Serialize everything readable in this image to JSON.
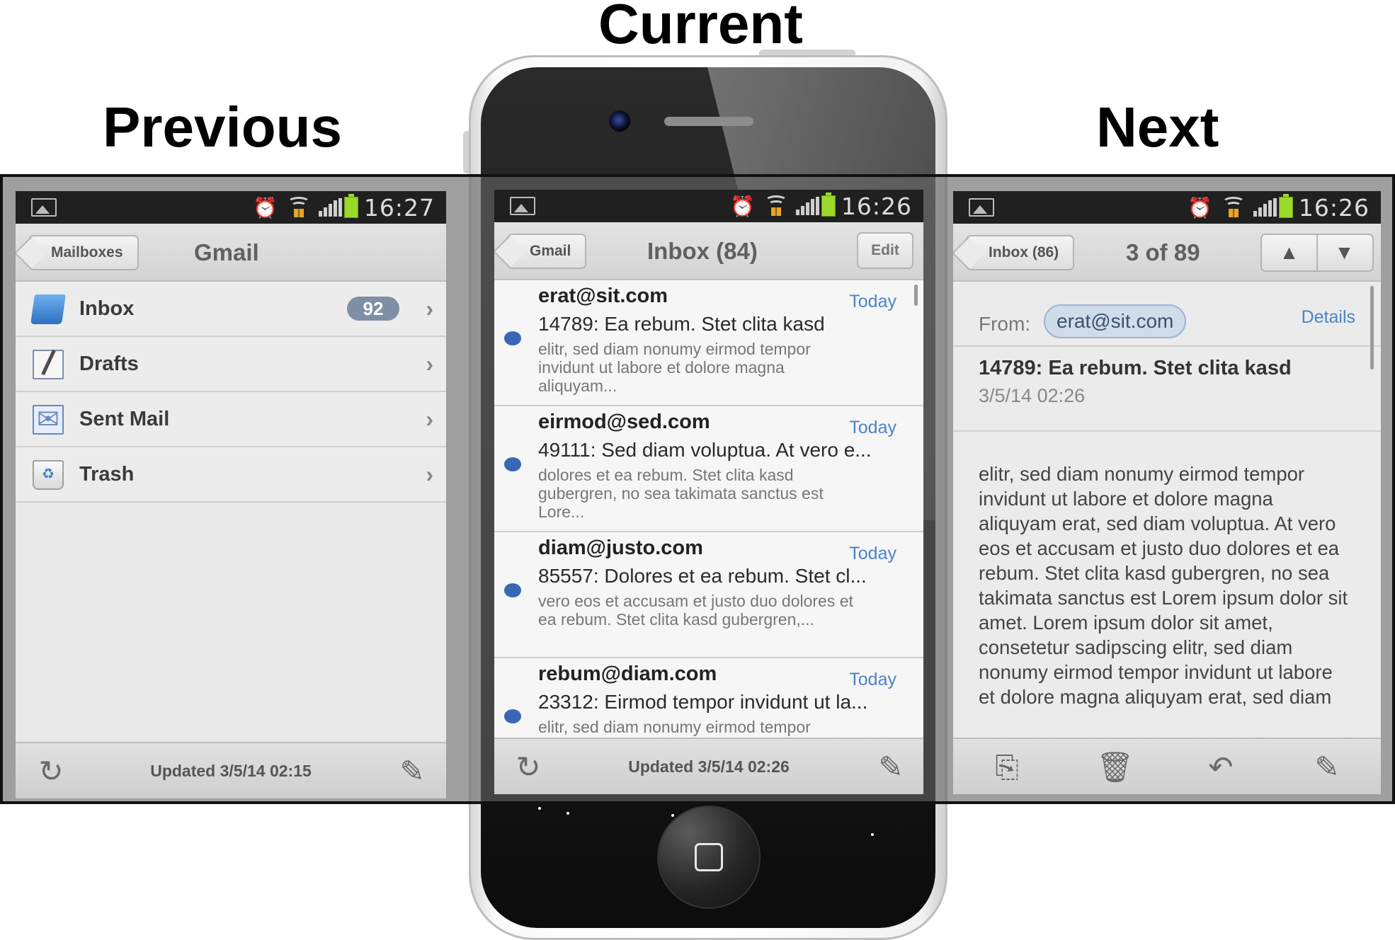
{
  "labels": {
    "previous": "Previous",
    "current": "Current",
    "next": "Next"
  },
  "previous_screen": {
    "status": {
      "time": "16:27"
    },
    "navbar": {
      "back_label": "Mailboxes",
      "title": "Gmail"
    },
    "mailboxes": [
      {
        "label": "Inbox",
        "badge": "92",
        "icon": "folder-icon"
      },
      {
        "label": "Drafts",
        "badge": "",
        "icon": "drafts-icon"
      },
      {
        "label": "Sent Mail",
        "badge": "",
        "icon": "sent-mail-icon"
      },
      {
        "label": "Trash",
        "badge": "",
        "icon": "trash-icon"
      }
    ],
    "toolbar": {
      "updated": "Updated 3/5/14 02:15",
      "refresh_icon": "refresh-icon",
      "compose_icon": "compose-icon"
    }
  },
  "current_screen": {
    "status": {
      "time": "16:26"
    },
    "navbar": {
      "back_label": "Gmail",
      "title": "Inbox (84)",
      "edit_label": "Edit"
    },
    "messages": [
      {
        "sender": "erat@sit.com",
        "date": "Today",
        "subject": "14789: Ea rebum. Stet clita kasd",
        "preview": "elitr, sed diam nonumy eirmod tempor invidunt ut labore et dolore magna aliquyam...",
        "unread": true
      },
      {
        "sender": "eirmod@sed.com",
        "date": "Today",
        "subject": "49111: Sed diam voluptua. At vero e...",
        "preview": "dolores et ea rebum. Stet clita kasd gubergren, no sea takimata sanctus est Lore...",
        "unread": true
      },
      {
        "sender": "diam@justo.com",
        "date": "Today",
        "subject": "85557: Dolores et ea rebum. Stet cl...",
        "preview": "vero eos et accusam et justo duo dolores et ea rebum. Stet clita kasd gubergren,...",
        "unread": true
      },
      {
        "sender": "rebum@diam.com",
        "date": "Today",
        "subject": "23312: Eirmod tempor invidunt ut la...",
        "preview": "elitr, sed diam nonumy eirmod tempor invidunt ut labore et dolore magna",
        "unread": true
      }
    ],
    "toolbar": {
      "updated": "Updated 3/5/14 02:26"
    }
  },
  "next_screen": {
    "status": {
      "time": "16:26"
    },
    "navbar": {
      "back_label": "Inbox (86)",
      "title": "3 of 89"
    },
    "message": {
      "from_label": "From:",
      "from": "erat@sit.com",
      "details_label": "Details",
      "subject": "14789: Ea rebum. Stet clita kasd",
      "date": "3/5/14 02:26",
      "body": "elitr, sed diam nonumy eirmod tempor invidunt ut labore et dolore magna aliquyam erat, sed diam voluptua. At vero eos et accusam et justo duo dolores et ea rebum. Stet clita kasd gubergren, no sea takimata sanctus est Lorem ipsum dolor sit amet. Lorem ipsum dolor sit amet, consetetur sadipscing elitr, sed diam nonumy eirmod tempor invidunt ut labore et dolore magna aliquyam erat, sed diam"
    },
    "toolbar": {
      "icons": [
        "move-icon",
        "trash-icon",
        "reply-icon",
        "compose-icon"
      ]
    }
  },
  "colors": {
    "accent": "#4a84c8",
    "unread_dot": "#3a67b5",
    "badge": "#7f8fa6",
    "battery": "#9bd92a",
    "band": "#646464"
  }
}
